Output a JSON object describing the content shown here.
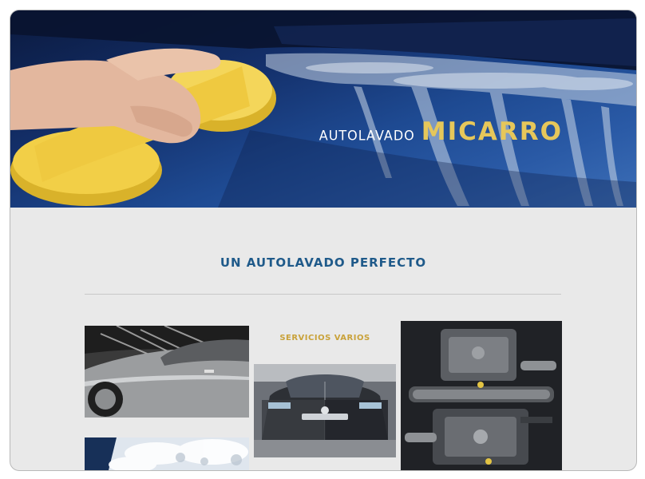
{
  "hero": {
    "brand_prefix": "AUTOLAVADO",
    "brand_name": "MICARRO",
    "image": "hand-washing-car-hood-with-sponge"
  },
  "main": {
    "section_title": "UN AUTOLAVADO PERFECTO",
    "services_label": "SERVICIOS VARIOS",
    "photos": [
      {
        "name": "silver-car-pressure-wash-photo"
      },
      {
        "name": "before-after-clean-car-photo"
      },
      {
        "name": "engine-bay-photo"
      },
      {
        "name": "car-foam-wash-photo"
      }
    ]
  },
  "colors": {
    "accent_gold": "#e6c75a",
    "title_blue": "#1f5a8a",
    "page_bg": "#e9e9e9"
  }
}
